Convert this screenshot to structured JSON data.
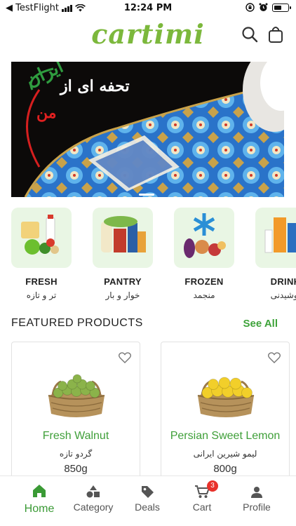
{
  "status_bar": {
    "carrier": "◀ TestFlight",
    "time": "12:24 PM",
    "battery_level": 0.6
  },
  "header": {
    "logo": "cartimi",
    "icons": [
      "search-icon",
      "shopping-bag-icon"
    ]
  },
  "banner": {
    "headline": "تحفه ای از",
    "word_green": "ایران",
    "word_red": "من"
  },
  "categories": [
    {
      "en": "FRESH",
      "fa": "تر و تازه"
    },
    {
      "en": "PANTRY",
      "fa": "خوار و بار"
    },
    {
      "en": "FROZEN",
      "fa": "منجمد"
    },
    {
      "en": "DRINK",
      "fa": "نوشیدنی"
    }
  ],
  "featured": {
    "title": "FEATURED PRODUCTS",
    "see_all": "See All"
  },
  "products": [
    {
      "name": "Fresh Walnut",
      "fa": "گردو تازه",
      "weight": "850g",
      "fruit_color": "#8bb34a"
    },
    {
      "name": "Persian Sweet Lemon",
      "fa": "لیمو شیرین ایرانی",
      "weight": "800g",
      "fruit_color": "#f2cf2a"
    }
  ],
  "tabbar": {
    "items": [
      {
        "label": "Home",
        "icon": "home-icon"
      },
      {
        "label": "Category",
        "icon": "shapes-icon"
      },
      {
        "label": "Deals",
        "icon": "tag-icon"
      },
      {
        "label": "Cart",
        "icon": "cart-icon"
      },
      {
        "label": "Profile",
        "icon": "user-icon"
      }
    ],
    "cart_badge": "3",
    "active": "Home"
  },
  "colors": {
    "brand_green": "#7cb83c",
    "accent_green": "#3ea33a",
    "tile_bg": "#e9f6e4",
    "badge_red": "#e8312a"
  }
}
